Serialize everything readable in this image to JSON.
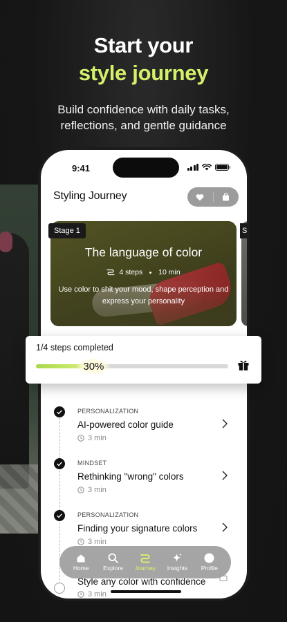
{
  "hero": {
    "title_line1": "Start your",
    "title_line2": "style journey",
    "subtitle_line1": "Build confidence with daily tasks,",
    "subtitle_line2": "reflections, and gentle guidance"
  },
  "colors": {
    "accent": "#d4f06a",
    "background": "#151515",
    "card_olive": "#5a5b26",
    "progress_fill": "#a7d94a"
  },
  "status_bar": {
    "time": "9:41"
  },
  "header": {
    "title": "Styling Journey",
    "icons": [
      "heart-icon",
      "bag-icon"
    ]
  },
  "stage_card": {
    "badge": "Stage 1",
    "next_badge": "S",
    "title": "The language of color",
    "steps": "4 steps",
    "duration": "10 min",
    "description": "Use color to shit your mood, shape perception and express your personality"
  },
  "progress": {
    "label": "1/4 steps completed",
    "percent_label": "30%",
    "value": 0.3
  },
  "steps": [
    {
      "category": "PERSONALIZATION",
      "title": "AI-powered color guide",
      "duration": "3 min",
      "done": true
    },
    {
      "category": "MINDSET",
      "title": "Rethinking \"wrong\" colors",
      "duration": "3 min",
      "done": true
    },
    {
      "category": "PERSONALIZATION",
      "title": "Finding your signature colors",
      "duration": "3 min",
      "done": true
    },
    {
      "category": "",
      "title": "Style any color with confidence",
      "duration": "3 min",
      "done": false,
      "locked": true
    }
  ],
  "tabs": [
    {
      "label": "Home",
      "icon": "home-icon"
    },
    {
      "label": "Explore",
      "icon": "search-icon"
    },
    {
      "label": "Journey",
      "icon": "journey-icon",
      "active": true
    },
    {
      "label": "Insights",
      "icon": "sparkle-icon"
    },
    {
      "label": "Profile",
      "icon": "profile-icon"
    }
  ]
}
